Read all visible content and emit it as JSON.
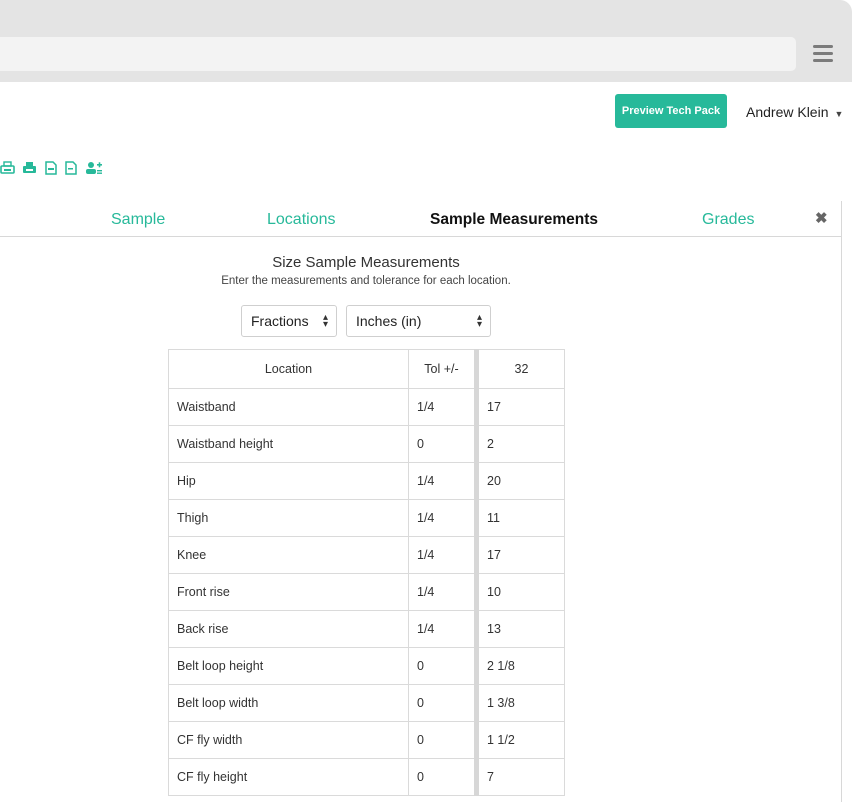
{
  "header": {
    "preview_button": "Preview Tech Pack",
    "user_name": "Andrew Klein",
    "user_caret": "▼"
  },
  "toolbar": {
    "icons": [
      "print-icon",
      "print-filled-icon",
      "pdf-icon",
      "pdf-outline-icon",
      "add-user-icon"
    ]
  },
  "tabs": {
    "sample": "Sample",
    "locations": "Locations",
    "sample_measurements": "Sample Measurements",
    "grades": "Grades",
    "close": "✖"
  },
  "content": {
    "heading": "Size Sample Measurements",
    "subheading": "Enter the measurements and tolerance for each location.",
    "fraction_select": "Fractions",
    "unit_select": "Inches (in)"
  },
  "table": {
    "headers": {
      "location": "Location",
      "tolerance": "Tol +/-",
      "size": "32"
    },
    "rows": [
      {
        "location": "Waistband",
        "tolerance": "1/4",
        "value": "17"
      },
      {
        "location": "Waistband height",
        "tolerance": "0",
        "value": "2"
      },
      {
        "location": "Hip",
        "tolerance": "1/4",
        "value": "20"
      },
      {
        "location": "Thigh",
        "tolerance": "1/4",
        "value": "11"
      },
      {
        "location": "Knee",
        "tolerance": "1/4",
        "value": "17"
      },
      {
        "location": "Front rise",
        "tolerance": "1/4",
        "value": "10"
      },
      {
        "location": "Back rise",
        "tolerance": "1/4",
        "value": "13"
      },
      {
        "location": "Belt loop height",
        "tolerance": "0",
        "value": "2 1/8"
      },
      {
        "location": "Belt loop width",
        "tolerance": "0",
        "value": "1 3/8"
      },
      {
        "location": "CF fly width",
        "tolerance": "0",
        "value": "1 1/2"
      },
      {
        "location": "CF fly height",
        "tolerance": "0",
        "value": "7"
      }
    ]
  },
  "colors": {
    "accent": "#27b99a",
    "chrome": "#e4e4e4"
  }
}
